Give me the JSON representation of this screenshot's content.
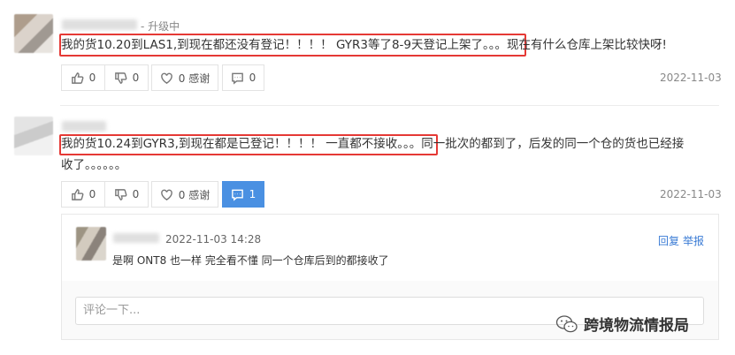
{
  "comments": [
    {
      "level": "- 升级中",
      "text_highlight": "我的货10.20到LAS1,到现在都还没有登记！！！！ GYR3等了8-9天登记上架了。。。",
      "text_rest": "现在有什么仓库上架比较快呀!",
      "like_count": "0",
      "dislike_count": "0",
      "thanks_label": "0 感谢",
      "reply_count": "0",
      "date": "2022-11-03"
    },
    {
      "level": "",
      "text_highlight": "我的货10.24到GYR3,到现在都是已登记！！！！ 一直都不接收。。。",
      "text_rest": "同一批次的都到了，后发的同一个仓的货也已经接",
      "text_line2": "收了。。。。。。",
      "like_count": "0",
      "dislike_count": "0",
      "thanks_label": "0 感谢",
      "reply_count": "1",
      "date": "2022-11-03",
      "replies": [
        {
          "time": "2022-11-03 14:28",
          "text": "是啊 ONT8 也一样 完全看不懂 同一个仓库后到的都接收了",
          "reply_label": "回复",
          "report_label": "举报"
        }
      ],
      "comment_placeholder": "评论一下..."
    }
  ],
  "watermark": "跨境物流情报局",
  "colors": {
    "highlight": "#e53935",
    "accent": "#4a90e2",
    "link": "#3a7bd5"
  }
}
